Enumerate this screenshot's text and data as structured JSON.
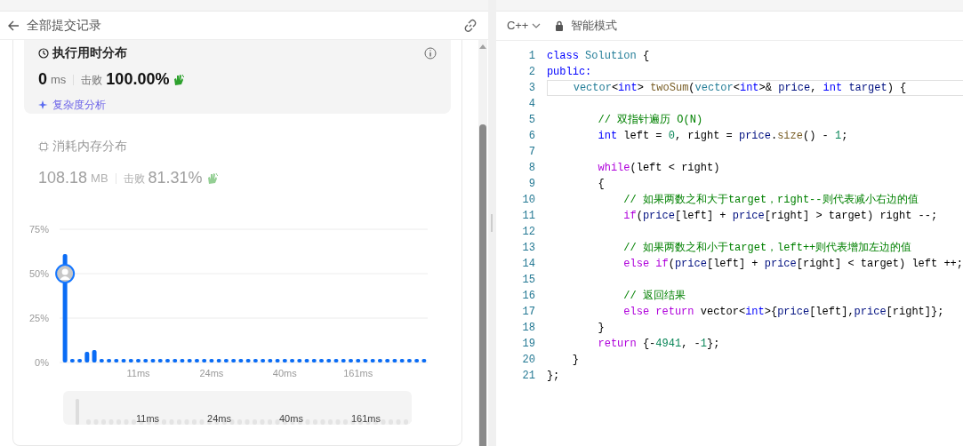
{
  "left_panel": {
    "header": {
      "title": "全部提交记录"
    },
    "runtime": {
      "title": "执行用时分布",
      "value": "0",
      "unit": "ms",
      "beat_label": "击败",
      "beat": "100.00%",
      "analysis_link": "复杂度分析"
    },
    "memory": {
      "title": "消耗内存分布",
      "value": "108.18",
      "unit": "MB",
      "beat_label": "击败",
      "beat": "81.31%",
      "chart_data": {
        "type": "bar",
        "categories": [
          null,
          null,
          null,
          null,
          null,
          null,
          null,
          null,
          null,
          null,
          "11ms",
          null,
          null,
          null,
          null,
          null,
          null,
          null,
          null,
          null,
          "24ms",
          null,
          null,
          null,
          null,
          null,
          null,
          null,
          null,
          null,
          "40ms",
          null,
          null,
          null,
          null,
          null,
          null,
          null,
          null,
          null,
          "161ms",
          null,
          null,
          null,
          null,
          null,
          null,
          null,
          null,
          null
        ],
        "series": [
          {
            "color": "#0a6cf5",
            "values": [
              61,
              2,
              2,
              6,
              7,
              2,
              2,
              2,
              2,
              2,
              2,
              2,
              2,
              2,
              2,
              2,
              2,
              2,
              2,
              2,
              2,
              2,
              2,
              2,
              2,
              2,
              2,
              2,
              2,
              2,
              2,
              2,
              2,
              2,
              2,
              2,
              2,
              2,
              2,
              2,
              2,
              2,
              2,
              2,
              2,
              2,
              2,
              2,
              2,
              2
            ]
          }
        ],
        "ylim": [
          0,
          75
        ],
        "yticks": [
          {
            "value": 0,
            "label": "0%"
          },
          {
            "value": 25,
            "label": "25%"
          },
          {
            "value": 50,
            "label": "50%"
          },
          {
            "value": 75,
            "label": "75%"
          }
        ]
      },
      "navigator": {
        "labels": [
          "11ms",
          "24ms",
          "40ms",
          "161ms"
        ]
      }
    }
  },
  "editor": {
    "language": "C++",
    "mode": "智能模式",
    "lines": [
      {
        "number": "1",
        "current": false,
        "tokens": [
          {
            "text": "class ",
            "kind": "keyword"
          },
          {
            "text": "Solution",
            "kind": "type"
          },
          {
            "text": " {",
            "kind": "plain"
          }
        ]
      },
      {
        "number": "2",
        "current": false,
        "tokens": [
          {
            "text": "public:",
            "kind": "keyword"
          }
        ]
      },
      {
        "number": "3",
        "current": true,
        "tokens": [
          {
            "text": "    vector",
            "kind": "type"
          },
          {
            "text": "<",
            "kind": "plain"
          },
          {
            "text": "int",
            "kind": "keyword"
          },
          {
            "text": "> ",
            "kind": "plain"
          },
          {
            "text": "twoSum",
            "kind": "function"
          },
          {
            "text": "(",
            "kind": "plain"
          },
          {
            "text": "vector",
            "kind": "type"
          },
          {
            "text": "<",
            "kind": "plain"
          },
          {
            "text": "int",
            "kind": "keyword"
          },
          {
            "text": ">& ",
            "kind": "plain"
          },
          {
            "text": "price",
            "kind": "variable"
          },
          {
            "text": ", ",
            "kind": "plain"
          },
          {
            "text": "int",
            "kind": "keyword"
          },
          {
            "text": " target",
            "kind": "variable"
          },
          {
            "text": ") {",
            "kind": "plain"
          }
        ]
      },
      {
        "number": "4",
        "current": false
      },
      {
        "number": "5",
        "current": false,
        "tokens": [
          {
            "text": "        // 双指针遍历 O(N)",
            "kind": "comment"
          }
        ]
      },
      {
        "number": "6",
        "current": false,
        "tokens": [
          {
            "text": "        int",
            "kind": "keyword"
          },
          {
            "text": " left = ",
            "kind": "plain"
          },
          {
            "text": "0",
            "kind": "number"
          },
          {
            "text": ", right = ",
            "kind": "plain"
          },
          {
            "text": "price",
            "kind": "variable"
          },
          {
            "text": ".",
            "kind": "plain"
          },
          {
            "text": "size",
            "kind": "function"
          },
          {
            "text": "() - ",
            "kind": "plain"
          },
          {
            "text": "1",
            "kind": "number"
          },
          {
            "text": ";",
            "kind": "plain"
          }
        ]
      },
      {
        "number": "7",
        "current": false
      },
      {
        "number": "8",
        "current": false,
        "tokens": [
          {
            "text": "        while",
            "kind": "control"
          },
          {
            "text": "(left < right)",
            "kind": "plain"
          }
        ]
      },
      {
        "number": "9",
        "current": false,
        "tokens": [
          {
            "text": "        {",
            "kind": "plain"
          }
        ]
      },
      {
        "number": "10",
        "current": false,
        "tokens": [
          {
            "text": "            // 如果两数之和大于target，right--则代表减小右边的值",
            "kind": "comment"
          }
        ]
      },
      {
        "number": "11",
        "current": false,
        "tokens": [
          {
            "text": "            if",
            "kind": "control"
          },
          {
            "text": "(",
            "kind": "plain"
          },
          {
            "text": "price",
            "kind": "variable"
          },
          {
            "text": "[left] + ",
            "kind": "plain"
          },
          {
            "text": "price",
            "kind": "variable"
          },
          {
            "text": "[right] > target) right --;",
            "kind": "plain"
          }
        ]
      },
      {
        "number": "12",
        "current": false
      },
      {
        "number": "13",
        "current": false,
        "tokens": [
          {
            "text": "            // 如果两数之和小于target，left++则代表增加左边的值",
            "kind": "comment"
          }
        ]
      },
      {
        "number": "14",
        "current": false,
        "tokens": [
          {
            "text": "            else if",
            "kind": "control"
          },
          {
            "text": "(",
            "kind": "plain"
          },
          {
            "text": "price",
            "kind": "variable"
          },
          {
            "text": "[left] + ",
            "kind": "plain"
          },
          {
            "text": "price",
            "kind": "variable"
          },
          {
            "text": "[right] < target) left ++;",
            "kind": "plain"
          }
        ]
      },
      {
        "number": "15",
        "current": false
      },
      {
        "number": "16",
        "current": false,
        "tokens": [
          {
            "text": "            // 返回结果",
            "kind": "comment"
          }
        ]
      },
      {
        "number": "17",
        "current": false,
        "tokens": [
          {
            "text": "            else return",
            "kind": "control"
          },
          {
            "text": " vector<",
            "kind": "plain"
          },
          {
            "text": "int",
            "kind": "keyword"
          },
          {
            "text": ">{",
            "kind": "plain"
          },
          {
            "text": "price",
            "kind": "variable"
          },
          {
            "text": "[left],",
            "kind": "plain"
          },
          {
            "text": "price",
            "kind": "variable"
          },
          {
            "text": "[right]};",
            "kind": "plain"
          }
        ]
      },
      {
        "number": "18",
        "current": false,
        "tokens": [
          {
            "text": "        }",
            "kind": "plain"
          }
        ]
      },
      {
        "number": "19",
        "current": false,
        "tokens": [
          {
            "text": "        return",
            "kind": "control"
          },
          {
            "text": " {-",
            "kind": "plain"
          },
          {
            "text": "4941",
            "kind": "number"
          },
          {
            "text": ", -",
            "kind": "plain"
          },
          {
            "text": "1",
            "kind": "number"
          },
          {
            "text": "};",
            "kind": "plain"
          }
        ]
      },
      {
        "number": "20",
        "current": false,
        "tokens": [
          {
            "text": "    }",
            "kind": "plain"
          }
        ]
      },
      {
        "number": "21",
        "current": false,
        "tokens": [
          {
            "text": "};",
            "kind": "plain"
          }
        ]
      }
    ]
  }
}
